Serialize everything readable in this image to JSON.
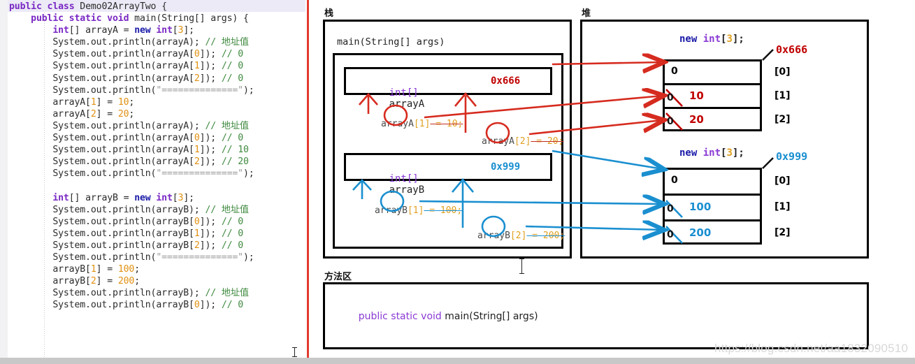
{
  "editor": {
    "code_lines": [
      [
        {
          "t": "public ",
          "c": "k"
        },
        {
          "t": "class ",
          "c": "k"
        },
        {
          "t": "Demo02ArrayTwo ",
          "c": "cls"
        },
        {
          "t": "{",
          "c": "pl"
        }
      ],
      [
        {
          "t": "    public static void ",
          "c": "k"
        },
        {
          "t": "main(String[] args) {",
          "c": "pl"
        }
      ],
      [
        {
          "t": "        ",
          "c": "pl"
        },
        {
          "t": "int",
          "c": "k"
        },
        {
          "t": "[] arrayA = ",
          "c": "pl"
        },
        {
          "t": "new ",
          "c": "kb"
        },
        {
          "t": "int",
          "c": "k"
        },
        {
          "t": "[",
          "c": "pl"
        },
        {
          "t": "3",
          "c": "num"
        },
        {
          "t": "];",
          "c": "pl"
        }
      ],
      [
        {
          "t": "        System.out.println(arrayA); ",
          "c": "pl"
        },
        {
          "t": "// 地址值",
          "c": "cm"
        }
      ],
      [
        {
          "t": "        System.out.println(arrayA[",
          "c": "pl"
        },
        {
          "t": "0",
          "c": "num"
        },
        {
          "t": "]); ",
          "c": "pl"
        },
        {
          "t": "// 0",
          "c": "cm"
        }
      ],
      [
        {
          "t": "        System.out.println(arrayA[",
          "c": "pl"
        },
        {
          "t": "1",
          "c": "num"
        },
        {
          "t": "]); ",
          "c": "pl"
        },
        {
          "t": "// 0",
          "c": "cm"
        }
      ],
      [
        {
          "t": "        System.out.println(arrayA[",
          "c": "pl"
        },
        {
          "t": "2",
          "c": "num"
        },
        {
          "t": "]); ",
          "c": "pl"
        },
        {
          "t": "// 0",
          "c": "cm"
        }
      ],
      [
        {
          "t": "        System.out.println(",
          "c": "pl"
        },
        {
          "t": "\"==============\"",
          "c": "str"
        },
        {
          "t": ");",
          "c": "pl"
        }
      ],
      [
        {
          "t": "        arrayA[",
          "c": "pl"
        },
        {
          "t": "1",
          "c": "num"
        },
        {
          "t": "] = ",
          "c": "pl"
        },
        {
          "t": "10",
          "c": "num"
        },
        {
          "t": ";",
          "c": "pl"
        }
      ],
      [
        {
          "t": "        arrayA[",
          "c": "pl"
        },
        {
          "t": "2",
          "c": "num"
        },
        {
          "t": "] = ",
          "c": "pl"
        },
        {
          "t": "20",
          "c": "num"
        },
        {
          "t": ";",
          "c": "pl"
        }
      ],
      [
        {
          "t": "        System.out.println(arrayA); ",
          "c": "pl"
        },
        {
          "t": "// 地址值",
          "c": "cm"
        }
      ],
      [
        {
          "t": "        System.out.println(arrayA[",
          "c": "pl"
        },
        {
          "t": "0",
          "c": "num"
        },
        {
          "t": "]); ",
          "c": "pl"
        },
        {
          "t": "// 0",
          "c": "cm"
        }
      ],
      [
        {
          "t": "        System.out.println(arrayA[",
          "c": "pl"
        },
        {
          "t": "1",
          "c": "num"
        },
        {
          "t": "]); ",
          "c": "pl"
        },
        {
          "t": "// 10",
          "c": "cm"
        }
      ],
      [
        {
          "t": "        System.out.println(arrayA[",
          "c": "pl"
        },
        {
          "t": "2",
          "c": "num"
        },
        {
          "t": "]); ",
          "c": "pl"
        },
        {
          "t": "// 20",
          "c": "cm"
        }
      ],
      [
        {
          "t": "        System.out.println(",
          "c": "pl"
        },
        {
          "t": "\"==============\"",
          "c": "str"
        },
        {
          "t": ");",
          "c": "pl"
        }
      ],
      [
        {
          "t": "",
          "c": "pl"
        }
      ],
      [
        {
          "t": "        ",
          "c": "pl"
        },
        {
          "t": "int",
          "c": "k"
        },
        {
          "t": "[] arrayB = ",
          "c": "pl"
        },
        {
          "t": "new ",
          "c": "kb"
        },
        {
          "t": "int",
          "c": "k"
        },
        {
          "t": "[",
          "c": "pl"
        },
        {
          "t": "3",
          "c": "num"
        },
        {
          "t": "];",
          "c": "pl"
        }
      ],
      [
        {
          "t": "        System.out.println(arrayB); ",
          "c": "pl"
        },
        {
          "t": "// 地址值",
          "c": "cm"
        }
      ],
      [
        {
          "t": "        System.out.println(arrayB[",
          "c": "pl"
        },
        {
          "t": "0",
          "c": "num"
        },
        {
          "t": "]); ",
          "c": "pl"
        },
        {
          "t": "// 0",
          "c": "cm"
        }
      ],
      [
        {
          "t": "        System.out.println(arrayB[",
          "c": "pl"
        },
        {
          "t": "1",
          "c": "num"
        },
        {
          "t": "]); ",
          "c": "pl"
        },
        {
          "t": "// 0",
          "c": "cm"
        }
      ],
      [
        {
          "t": "        System.out.println(arrayB[",
          "c": "pl"
        },
        {
          "t": "2",
          "c": "num"
        },
        {
          "t": "]); ",
          "c": "pl"
        },
        {
          "t": "// 0",
          "c": "cm"
        }
      ],
      [
        {
          "t": "        System.out.println(",
          "c": "pl"
        },
        {
          "t": "\"==============\"",
          "c": "str"
        },
        {
          "t": ");",
          "c": "pl"
        }
      ],
      [
        {
          "t": "        arrayB[",
          "c": "pl"
        },
        {
          "t": "1",
          "c": "num"
        },
        {
          "t": "] = ",
          "c": "pl"
        },
        {
          "t": "100",
          "c": "num"
        },
        {
          "t": ";",
          "c": "pl"
        }
      ],
      [
        {
          "t": "        arrayB[",
          "c": "pl"
        },
        {
          "t": "2",
          "c": "num"
        },
        {
          "t": "] = ",
          "c": "pl"
        },
        {
          "t": "200",
          "c": "num"
        },
        {
          "t": ";",
          "c": "pl"
        }
      ],
      [
        {
          "t": "        System.out.println(arrayB); ",
          "c": "pl"
        },
        {
          "t": "// 地址值",
          "c": "cm"
        }
      ],
      [
        {
          "t": "        System.out.println(arrayB[",
          "c": "pl"
        },
        {
          "t": "0",
          "c": "num"
        },
        {
          "t": "]); ",
          "c": "pl"
        },
        {
          "t": "// 0",
          "c": "cm"
        }
      ]
    ]
  },
  "diagram": {
    "stack": {
      "title": "栈",
      "frame_label": "main(String[] args)",
      "variables": [
        {
          "type": "int[]",
          "name": "arrayA",
          "address": "0x666",
          "accent": "#c00000"
        },
        {
          "type": "int[]",
          "name": "arrayB",
          "address": "0x999",
          "accent": "#1a8fd0"
        }
      ],
      "annotations": [
        {
          "prefix": "arrayA",
          "index": "[1]",
          "assign": " = 10;"
        },
        {
          "prefix": "arrayA",
          "index": "[2]",
          "assign": " = 20;"
        },
        {
          "prefix": "arrayB",
          "index": "[1]",
          "assign": " = 100;"
        },
        {
          "prefix": "arrayB",
          "index": "[2]",
          "assign": " = 200;"
        }
      ]
    },
    "heap": {
      "title": "堆",
      "arrays": [
        {
          "alloc_new": "new",
          "alloc_type": "int",
          "alloc_size": "3",
          "alloc_tail": "];",
          "alloc_open": "[",
          "address": "0x666",
          "accent": "#c00000",
          "cells": [
            {
              "index": "[0]",
              "old": "0",
              "new": null
            },
            {
              "index": "[1]",
              "old": "0",
              "new": "10"
            },
            {
              "index": "[2]",
              "old": "0",
              "new": "20"
            }
          ]
        },
        {
          "alloc_new": "new",
          "alloc_type": "int",
          "alloc_size": "3",
          "alloc_tail": "];",
          "alloc_open": "[",
          "address": "0x999",
          "accent": "#1a8fd0",
          "cells": [
            {
              "index": "[0]",
              "old": "0",
              "new": null
            },
            {
              "index": "[1]",
              "old": "0",
              "new": "100"
            },
            {
              "index": "[2]",
              "old": "0",
              "new": "200"
            }
          ]
        }
      ]
    },
    "method_area": {
      "title": "方法区",
      "signature_keywords": "public static void ",
      "signature_rest": "main(String[] args)"
    }
  },
  "watermark": "https://blog.csdn.net/aa1832090510"
}
